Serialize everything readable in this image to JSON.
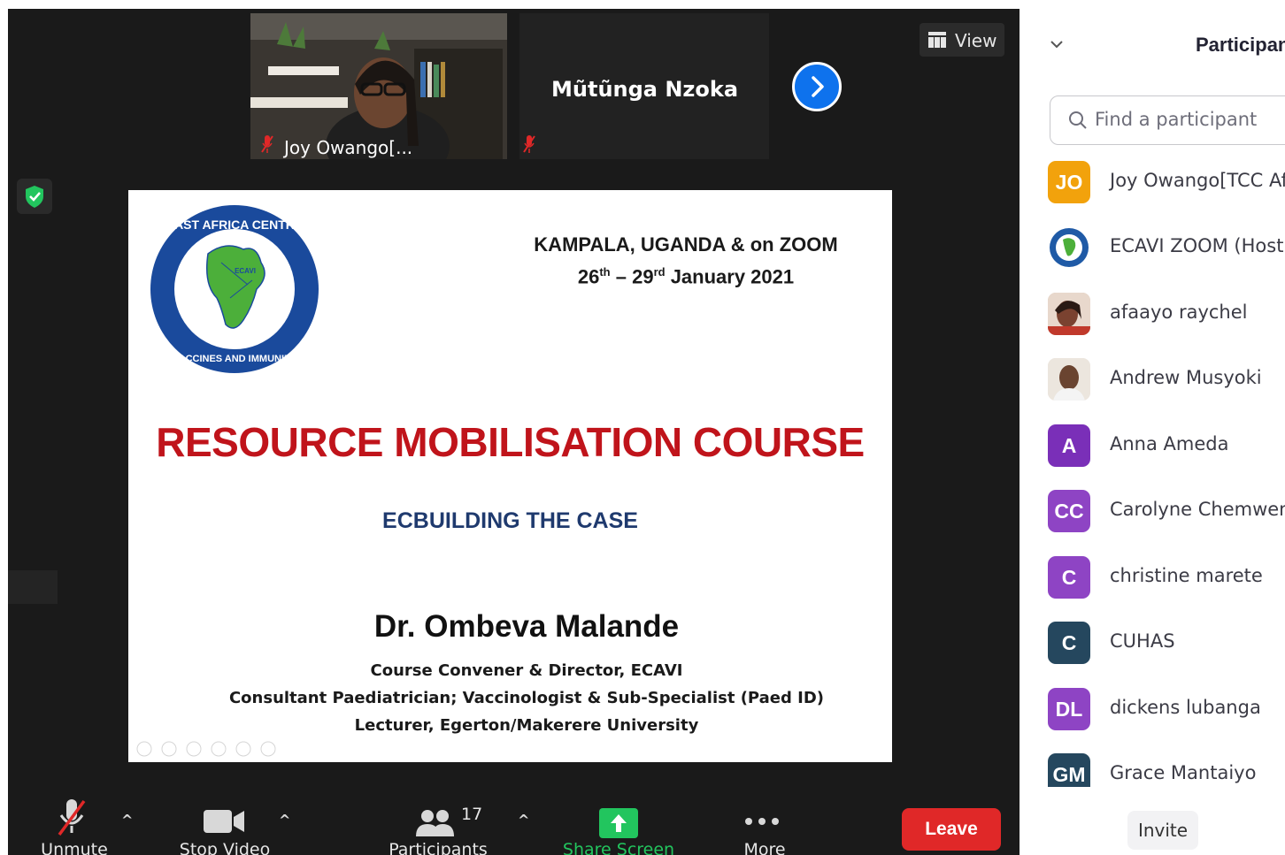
{
  "gallery": {
    "tiles": [
      {
        "name": "Joy Owango[...",
        "mic": "muted"
      },
      {
        "name": "Mũtũnga Nzoka",
        "mic": "muted"
      }
    ],
    "view_label": "View"
  },
  "slide": {
    "logo_text": "EAST AFRICA CENTRE FOR VACCINES AND IMMUNIZATION",
    "logo_abbr": "ECAVI",
    "location_line1": "KAMPALA, UGANDA &  on ZOOM",
    "date_start": "26",
    "date_start_suffix": "th",
    "date_dash": " – ",
    "date_end": "29",
    "date_end_suffix": "rd",
    "date_month_year": " January 2021",
    "title": "RESOURCE MOBILISATION COURSE",
    "subtitle": "ECBUILDING THE CASE",
    "presenter": "Dr. Ombeva Malande",
    "role1": "Course Convener & Director, ECAVI",
    "role2": "Consultant Paediatrician; Vaccinologist & Sub-Specialist (Paed ID)",
    "role3": "Lecturer, Egerton/Makerere University"
  },
  "toolbar": {
    "unmute": "Unmute",
    "stop_video": "Stop Video",
    "participants": "Participants",
    "participants_count": "17",
    "share_screen": "Share Screen",
    "more": "More",
    "leave": "Leave"
  },
  "panel": {
    "title": "Participants",
    "search_placeholder": "Find a participant",
    "invite": "Invite",
    "participants": [
      {
        "initials": "JO",
        "name": "Joy Owango[TCC Africa]",
        "color": "#f2a20c"
      },
      {
        "initials": "",
        "name": "ECAVI ZOOM (Host)",
        "color": "#1f5aa6"
      },
      {
        "initials": "",
        "name": "afaayo raychel",
        "color": "#8a4b3a"
      },
      {
        "initials": "",
        "name": "Andrew Musyoki",
        "color": "#c9b8a4"
      },
      {
        "initials": "A",
        "name": "Anna Ameda",
        "color": "#7a2fb8"
      },
      {
        "initials": "CC",
        "name": "Carolyne Chemweno",
        "color": "#8e44c4"
      },
      {
        "initials": "C",
        "name": "christine marete",
        "color": "#8e44c4"
      },
      {
        "initials": "C",
        "name": "CUHAS",
        "color": "#25475e"
      },
      {
        "initials": "DL",
        "name": "dickens lubanga",
        "color": "#8e44c4"
      },
      {
        "initials": "GM",
        "name": "Grace Mantaiyo",
        "color": "#25475e"
      }
    ]
  },
  "colors": {
    "leave": "#e02828",
    "share": "#22c55e",
    "accent": "#0e72ed",
    "title_red": "#c0141b",
    "subtitle_blue": "#1f3a6e"
  }
}
